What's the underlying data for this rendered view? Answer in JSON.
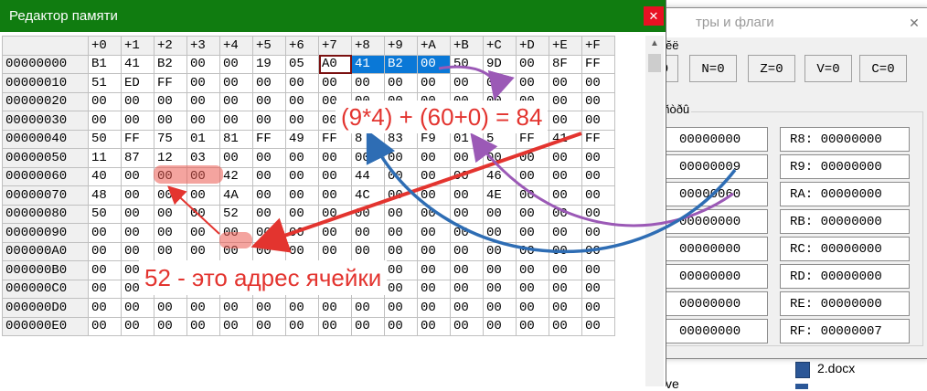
{
  "explorer": {
    "file_name": "2.docx",
    "partial_text": "ve"
  },
  "regwin": {
    "title": "тры и флаги",
    "close": "✕",
    "flags": [
      "0",
      "N=0",
      "Z=0",
      "V=0",
      "C=0"
    ],
    "partial_label1": "ĕë",
    "group_label": "ëñòðû",
    "left_regs": [
      "00000000",
      "00000009",
      "00000060",
      "00000000",
      "00000000",
      "00000000",
      "00000000",
      "00000000"
    ],
    "right_regs": [
      "R8: 00000000",
      "R9: 00000000",
      "RA: 00000000",
      "RB: 00000000",
      "RC: 00000000",
      "RD: 00000000",
      "RE: 00000000",
      "RF: 00000007"
    ]
  },
  "memwin": {
    "title": "Редактор памяти",
    "close": "✕",
    "columns": [
      "+0",
      "+1",
      "+2",
      "+3",
      "+4",
      "+5",
      "+6",
      "+7",
      "+8",
      "+9",
      "+A",
      "+B",
      "+C",
      "+D",
      "+E",
      "+F"
    ],
    "rows": [
      {
        "addr": "00000000",
        "cells": [
          "B1",
          "41",
          "B2",
          "00",
          "00",
          "19",
          "05",
          "A0",
          "41",
          "B2",
          "00",
          "50",
          "9D",
          "00",
          "8F",
          "FF"
        ]
      },
      {
        "addr": "00000010",
        "cells": [
          "51",
          "ED",
          "FF",
          "00",
          "00",
          "00",
          "00",
          "00",
          "00",
          "00",
          "00",
          "00",
          "00",
          "00",
          "00",
          "00"
        ]
      },
      {
        "addr": "00000020",
        "cells": [
          "00",
          "00",
          "00",
          "00",
          "00",
          "00",
          "00",
          "00",
          "00",
          "00",
          "00",
          "00",
          "00",
          "00",
          "00",
          "00"
        ]
      },
      {
        "addr": "00000030",
        "cells": [
          "00",
          "00",
          "00",
          "00",
          "00",
          "00",
          "00",
          "00",
          "00",
          "00",
          "00",
          "00",
          "00",
          "00",
          "00",
          "00"
        ]
      },
      {
        "addr": "00000040",
        "cells": [
          "50",
          "FF",
          "75",
          "01",
          "81",
          "FF",
          "49",
          "FF",
          "8",
          "83",
          "F9",
          "01",
          "5",
          "FF",
          "41",
          "FF"
        ]
      },
      {
        "addr": "00000050",
        "cells": [
          "11",
          "87",
          "12",
          "03",
          "00",
          "00",
          "00",
          "00",
          "00",
          "00",
          "00",
          "00",
          "00",
          "00",
          "00",
          "00"
        ]
      },
      {
        "addr": "00000060",
        "cells": [
          "40",
          "00",
          "00",
          "00",
          "42",
          "00",
          "00",
          "00",
          "44",
          "00",
          "00",
          "00",
          "46",
          "00",
          "00",
          "00"
        ]
      },
      {
        "addr": "00000070",
        "cells": [
          "48",
          "00",
          "00",
          "00",
          "4A",
          "00",
          "00",
          "00",
          "4C",
          "00",
          "00",
          "00",
          "4E",
          "00",
          "00",
          "00"
        ]
      },
      {
        "addr": "00000080",
        "cells": [
          "50",
          "00",
          "00",
          "00",
          "52",
          "00",
          "00",
          "00",
          "00",
          "00",
          "00",
          "00",
          "00",
          "00",
          "00",
          "00"
        ]
      },
      {
        "addr": "00000090",
        "cells": [
          "00",
          "00",
          "00",
          "00",
          "00",
          "00",
          "00",
          "00",
          "00",
          "00",
          "00",
          "00",
          "00",
          "00",
          "00",
          "00"
        ]
      },
      {
        "addr": "000000A0",
        "cells": [
          "00",
          "00",
          "00",
          "00",
          "00",
          "00",
          "00",
          "00",
          "00",
          "00",
          "00",
          "00",
          "00",
          "00",
          "00",
          "00"
        ]
      },
      {
        "addr": "000000B0",
        "cells": [
          "00",
          "00",
          "00",
          "00",
          "00",
          "00",
          "00",
          "00",
          "00",
          "00",
          "00",
          "00",
          "00",
          "00",
          "00",
          "00"
        ]
      },
      {
        "addr": "000000C0",
        "cells": [
          "00",
          "00",
          "00",
          "00",
          "00",
          "00",
          "00",
          "00",
          "00",
          "00",
          "00",
          "00",
          "00",
          "00",
          "00",
          "00"
        ]
      },
      {
        "addr": "000000D0",
        "cells": [
          "00",
          "00",
          "00",
          "00",
          "00",
          "00",
          "00",
          "00",
          "00",
          "00",
          "00",
          "00",
          "00",
          "00",
          "00",
          "00"
        ]
      },
      {
        "addr": "000000E0",
        "cells": [
          "00",
          "00",
          "00",
          "00",
          "00",
          "00",
          "00",
          "00",
          "00",
          "00",
          "00",
          "00",
          "00",
          "00",
          "00",
          "00"
        ]
      }
    ]
  },
  "annotations": {
    "formula": "(9*4) + (60+0) = 84",
    "note": "52 - это адрес ячейки",
    "colors": {
      "red": "#e3342f",
      "purple": "#9b59b6",
      "blue": "#2e6db4",
      "highlight": "#eb5a50"
    }
  }
}
